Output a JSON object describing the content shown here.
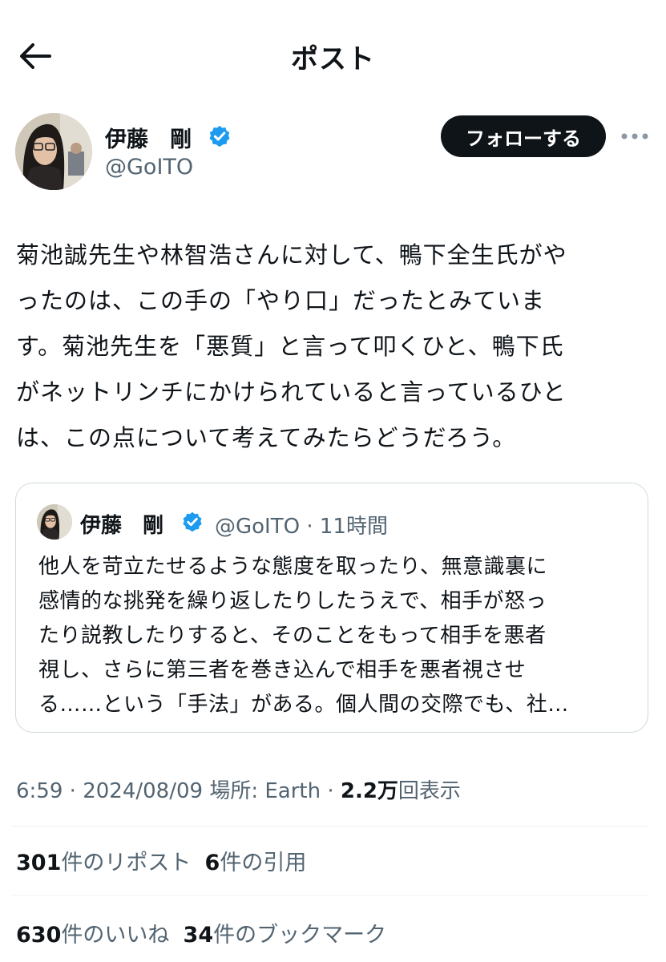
{
  "header": {
    "title": "ポスト",
    "back_icon": "arrow-left-icon"
  },
  "author": {
    "name": "伊藤　剛",
    "handle": "@GoITO",
    "verified": true,
    "follow_label": "フォローする",
    "more_icon": "more-horizontal-icon"
  },
  "post": {
    "lines": [
      "菊池誠先生や林智浩さんに対して、鴨下全生氏がや",
      "ったのは、この手の「やり口」だったとみていま",
      "す。菊池先生を「悪質」と言って叩くひと、鴨下氏",
      "がネットリンチにかけられていると言っているひと",
      "は、この点について考えてみたらどうだろう。"
    ]
  },
  "quote": {
    "name": "伊藤　剛",
    "handle": "@GoITO",
    "time": "· 11時間",
    "lines": [
      "他人を苛立たせるような態度を取ったり、無意識裏に",
      "感情的な挑発を繰り返したりしたうえで、相手が怒っ",
      "たり説教したりすると、そのことをもって相手を悪者",
      "視し、さらに第三者を巻き込んで相手を悪者視させ",
      "る……という「手法」がある。個人間の交際でも、社…"
    ]
  },
  "meta": {
    "time": "6:59",
    "date": "2024/08/09",
    "location_label": "場所: Earth",
    "views_count": "2.2万",
    "views_label": "回表示"
  },
  "stats": {
    "reposts_count": "301",
    "reposts_label": "件のリポスト",
    "quotes_count": "6",
    "quotes_label": "件の引用",
    "likes_count": "630",
    "likes_label": "件のいいね",
    "bookmarks_count": "34",
    "bookmarks_label": "件のブックマーク"
  },
  "colors": {
    "text": "#0f1419",
    "secondary": "#536471",
    "verified": "#1d9bf0",
    "border": "#cfd9de",
    "button_bg": "#0f1419"
  }
}
